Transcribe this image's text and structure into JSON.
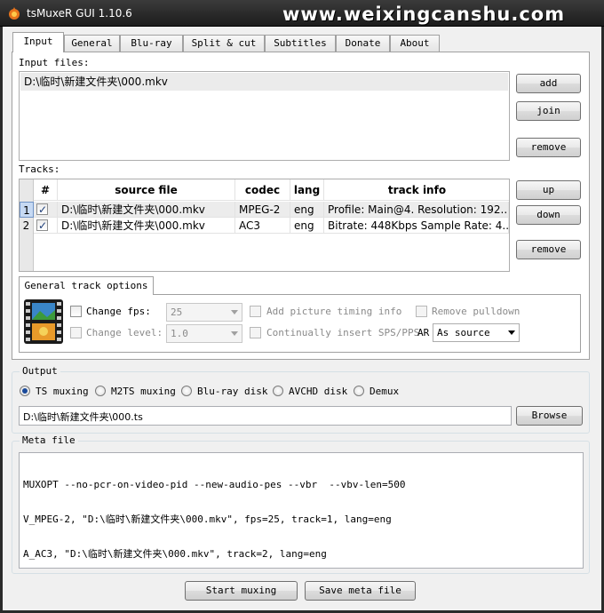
{
  "window": {
    "title": "tsMuxeR GUI 1.10.6",
    "watermark": "www.weixingcanshu.com",
    "icon": "tsmuxer-flame-icon"
  },
  "tabs": [
    "Input",
    "General",
    "Blu-ray",
    "Split & cut",
    "Subtitles",
    "Donate",
    "About"
  ],
  "input": {
    "files_label": "Input files:",
    "files": [
      "D:\\临时\\新建文件夹\\000.mkv"
    ],
    "add_label": "add",
    "join_label": "join",
    "remove_label": "remove"
  },
  "tracks": {
    "label": "Tracks:",
    "headers": [
      "#",
      "source file",
      "codec",
      "lang",
      "track info"
    ],
    "rows": [
      {
        "num": "1",
        "checked": true,
        "source": "D:\\临时\\新建文件夹\\000.mkv",
        "codec": "MPEG-2",
        "lang": "eng",
        "info": "Profile: Main@4. Resolution: 192..."
      },
      {
        "num": "2",
        "checked": true,
        "source": "D:\\临时\\新建文件夹\\000.mkv",
        "codec": "AC3",
        "lang": "eng",
        "info": "Bitrate: 448Kbps Sample Rate: 4..."
      }
    ],
    "up_label": "up",
    "down_label": "down",
    "remove_label": "remove"
  },
  "general_track_options": {
    "tab_label": "General track options",
    "change_fps_label": "Change fps:",
    "fps_value": "25",
    "change_level_label": "Change level:",
    "level_value": "1.0",
    "add_picture_timing_label": "Add picture timing info",
    "continually_insert_label": "Continually insert SPS/PPS",
    "remove_pulldown_label": "Remove pulldown",
    "ar_label": "AR",
    "ar_value": "As source"
  },
  "output": {
    "label": "Output",
    "options": [
      "TS muxing",
      "M2TS muxing",
      "Blu-ray disk",
      "AVCHD disk",
      "Demux"
    ],
    "selected": "TS muxing",
    "path": "D:\\临时\\新建文件夹\\000.ts",
    "browse_label": "Browse"
  },
  "meta": {
    "label": "Meta file",
    "lines": [
      "MUXOPT --no-pcr-on-video-pid --new-audio-pes --vbr  --vbv-len=500",
      "V_MPEG-2, \"D:\\临时\\新建文件夹\\000.mkv\", fps=25, track=1, lang=eng",
      "A_AC3, \"D:\\临时\\新建文件夹\\000.mkv\", track=2, lang=eng"
    ]
  },
  "footer": {
    "start_label": "Start muxing",
    "save_label": "Save meta file"
  },
  "colors": {
    "titlebar": "#2a2a2a",
    "accent_radio": "#1a4a9a",
    "selection": "#f0f0f0"
  }
}
